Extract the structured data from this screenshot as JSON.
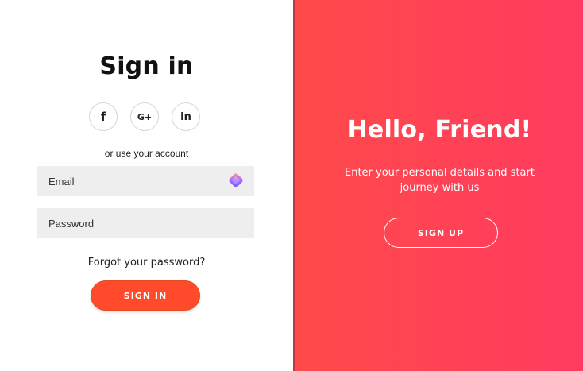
{
  "signin": {
    "title": "Sign in",
    "social": [
      {
        "label": "f",
        "icon": "facebook-icon"
      },
      {
        "label": "G+",
        "icon": "google-plus-icon"
      },
      {
        "label": "in",
        "icon": "linkedin-icon"
      }
    ],
    "alt_text": "or use your account",
    "email_placeholder": "Email",
    "password_placeholder": "Password",
    "forgot_text": "Forgot your password?",
    "submit_label": "SIGN IN"
  },
  "signup": {
    "title": "Hello, Friend!",
    "subtitle": "Enter your personal details and start journey with us",
    "button_label": "SIGN UP"
  },
  "colors": {
    "accent": "#ff4b2b",
    "gradient_start": "#ff4a4a",
    "gradient_end": "#ff3b5f",
    "field_bg": "#eeeeee"
  },
  "icons": {
    "field_extension": "extension-diamond-icon"
  }
}
